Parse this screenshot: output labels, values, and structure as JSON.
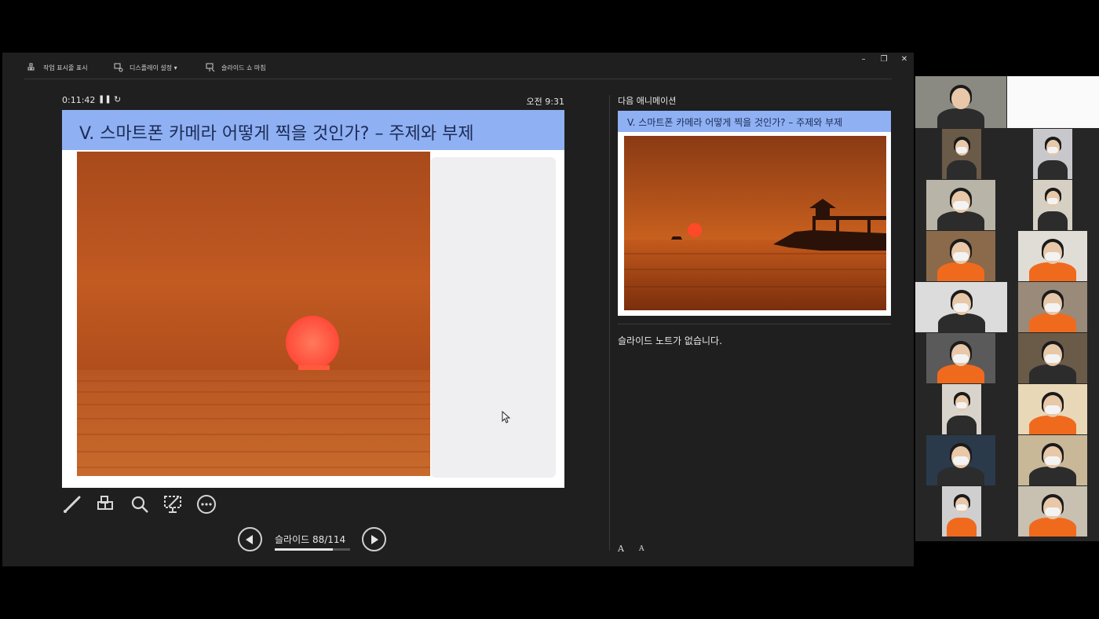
{
  "toolbar": {
    "show_taskbar": "작업 표시줄 표시",
    "display_settings": "디스플레이 설정 ▾",
    "end_slideshow": "슬라이드 쇼 마침",
    "minimize": "–",
    "restore": "❐",
    "close": "✕"
  },
  "timer": {
    "elapsed": "0:11:42",
    "pause_icon": "pause-icon",
    "restart_icon": "restart-icon"
  },
  "clock": "오전 9:31",
  "current_slide": {
    "title": "V. 스마트폰 카메라 어떻게 찍을 것인가? – 주제와 부제",
    "image": "sunset-over-sea"
  },
  "tools": [
    "pen-icon",
    "thumbnails-icon",
    "zoom-icon",
    "black-screen-icon",
    "more-icon"
  ],
  "navigation": {
    "counter": "슬라이드 88/114",
    "current": 88,
    "total": 114,
    "progress": 0.77
  },
  "next_pane": {
    "label": "다음 애니메이션",
    "title": "V. 스마트폰 카메라 어떻게 찍을 것인가? – 주제와 부제",
    "image": "sunset-with-pavilion"
  },
  "notes": "슬라이드 노트가 없습니다.",
  "font_controls": {
    "increase": "A",
    "decrease": "A"
  },
  "colors": {
    "title_bar": "#8fb0f3",
    "window_bg": "#1f1f1f",
    "vest_orange": "#f06a1e"
  }
}
